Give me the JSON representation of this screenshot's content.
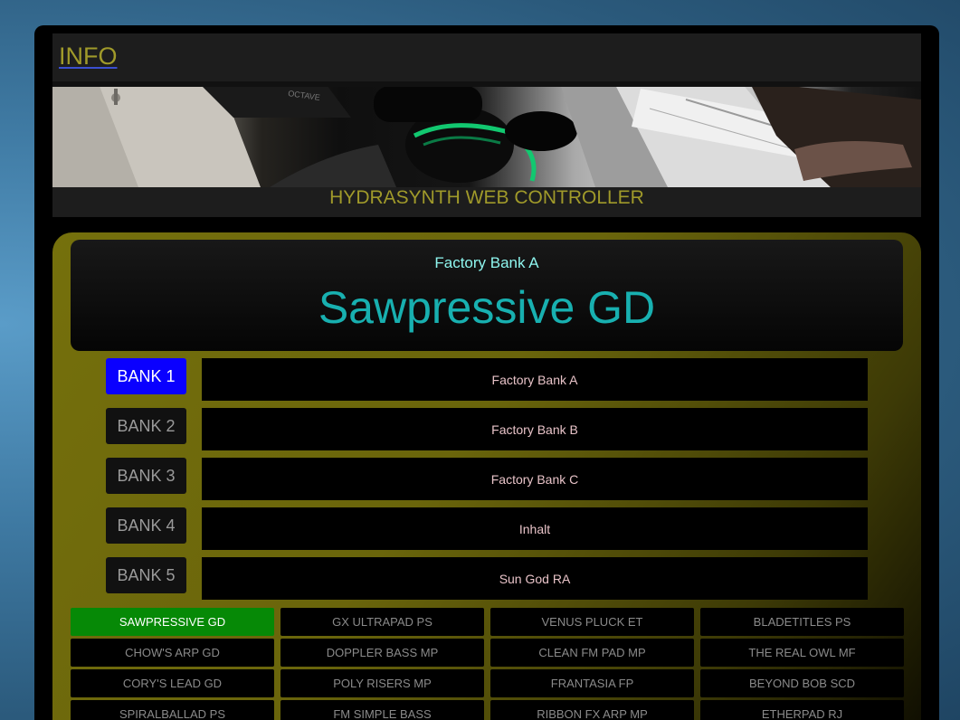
{
  "header": {
    "info_label": "INFO",
    "title": "HYDRASYNTH WEB CONTROLLER",
    "hero_labels": {
      "octave": "OCTAVE"
    }
  },
  "current_patch": {
    "bank_name": "Factory Bank A",
    "patch_name": "Sawpressive GD"
  },
  "banks": [
    {
      "label": "BANK 1",
      "name": "Factory Bank A",
      "active": true
    },
    {
      "label": "BANK 2",
      "name": "Factory Bank B",
      "active": false
    },
    {
      "label": "BANK 3",
      "name": "Factory Bank C",
      "active": false
    },
    {
      "label": "BANK 4",
      "name": "Inhalt",
      "active": false
    },
    {
      "label": "BANK 5",
      "name": "Sun God RA",
      "active": false
    }
  ],
  "patches": [
    "SAWPRESSIVE GD",
    "GX ULTRAPAD PS",
    "VENUS PLUCK ET",
    "BLADETITLES PS",
    "CHOW'S ARP GD",
    "DOPPLER BASS MP",
    "CLEAN FM PAD MP",
    "THE REAL OWL MF",
    "CORY'S LEAD GD",
    "POLY RISERS MP",
    "FRANTASIA FP",
    "BEYOND BOB SCD",
    "SPIRALBALLAD PS",
    "FM SIMPLE BASS",
    "RIBBON FX ARP MP",
    "ETHERPAD RJ"
  ],
  "active_patch": "SAWPRESSIVE GD",
  "colors": {
    "accent_olive": "#a09a2a",
    "active_bank": "#0a00ff",
    "active_patch": "#068906",
    "patch_name": "#18b0b0",
    "bank_subtitle": "#8ef5ee",
    "bank_name_text": "#e8c3c8"
  }
}
